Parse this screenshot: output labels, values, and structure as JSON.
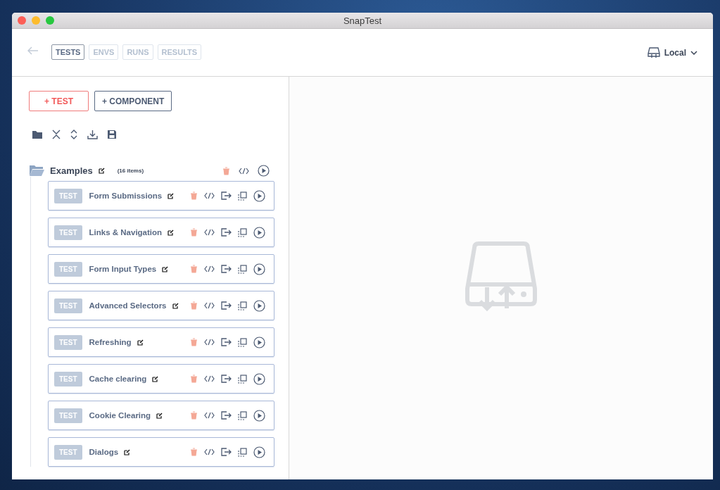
{
  "window": {
    "title": "SnapTest"
  },
  "tabs": [
    {
      "label": "TESTS",
      "selected": true
    },
    {
      "label": "ENVS",
      "selected": false
    },
    {
      "label": "RUNS",
      "selected": false
    },
    {
      "label": "RESULTS",
      "selected": false
    }
  ],
  "environment": {
    "label": "Local"
  },
  "buttons": [
    {
      "label": "+ TEST",
      "kind": "primary"
    },
    {
      "label": "+ COMPONENT",
      "kind": "secondary"
    }
  ],
  "folder": {
    "name": "Examples",
    "count": "(16 items)",
    "tests": [
      {
        "badge": "TEST",
        "name": "Form Submissions"
      },
      {
        "badge": "TEST",
        "name": "Links & Navigation"
      },
      {
        "badge": "TEST",
        "name": "Form Input Types"
      },
      {
        "badge": "TEST",
        "name": "Advanced Selectors"
      },
      {
        "badge": "TEST",
        "name": "Refreshing"
      },
      {
        "badge": "TEST",
        "name": "Cache clearing"
      },
      {
        "badge": "TEST",
        "name": "Cookie Clearing"
      },
      {
        "badge": "TEST",
        "name": "Dialogs"
      }
    ]
  }
}
